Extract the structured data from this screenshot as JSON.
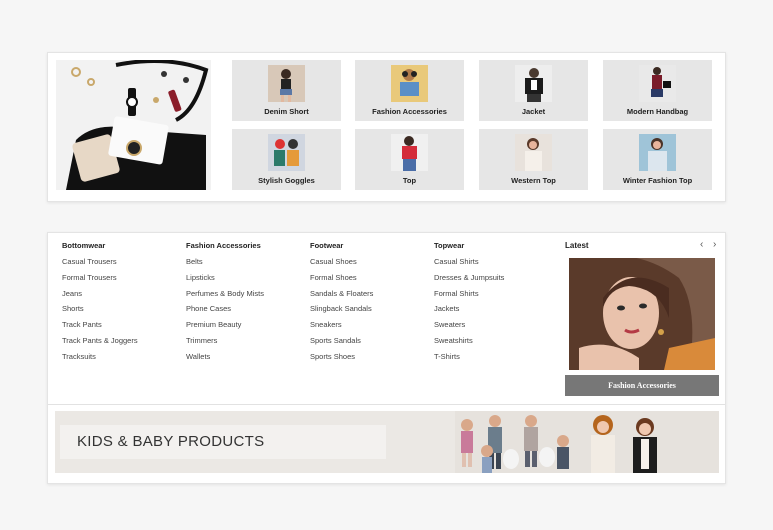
{
  "categories": [
    {
      "label": "Denim Short",
      "icon": "denim-short-photo"
    },
    {
      "label": "Fashion Accessories",
      "icon": "fashion-accessories-photo"
    },
    {
      "label": "Jacket",
      "icon": "jacket-photo"
    },
    {
      "label": "Modern Handbag",
      "icon": "handbag-photo"
    },
    {
      "label": "Stylish Goggles",
      "icon": "goggles-photo"
    },
    {
      "label": "Top",
      "icon": "top-photo"
    },
    {
      "label": "Western Top",
      "icon": "western-top-photo"
    },
    {
      "label": "Winter Fashion Top",
      "icon": "winter-top-photo"
    }
  ],
  "menu": {
    "bottomwear": {
      "title": "Bottomwear",
      "items": [
        "Casual Trousers",
        "Formal Trousers",
        "Jeans",
        "Shorts",
        "Track Pants",
        "Track Pants & Joggers",
        "Tracksuits"
      ]
    },
    "accessories": {
      "title": "Fashion Accessories",
      "items": [
        "Belts",
        "Lipsticks",
        "Perfumes & Body Mists",
        "Phone Cases",
        "Premium Beauty",
        "Trimmers",
        "Wallets"
      ]
    },
    "footwear": {
      "title": "Footwear",
      "items": [
        "Casual Shoes",
        "Formal Shoes",
        "Sandals & Floaters",
        "Slingback Sandals",
        "Sneakers",
        "Sports Sandals",
        "Sports Shoes"
      ]
    },
    "topwear": {
      "title": "Topwear",
      "items": [
        "Casual Shirts",
        "Dresses & Jumpsuits",
        "Formal Shirts",
        "Jackets",
        "Sweaters",
        "Sweatshirts",
        "T-Shirts"
      ]
    }
  },
  "latest": {
    "title": "Latest",
    "prev": "‹",
    "next": "›",
    "button": "Fashion Accessories"
  },
  "banner": {
    "title": "KIDS & BABY PRODUCTS"
  },
  "colors": {
    "tile_bg": "#e6e6e6",
    "button_bg": "#777777",
    "banner_bg": "#ebe8e4"
  }
}
